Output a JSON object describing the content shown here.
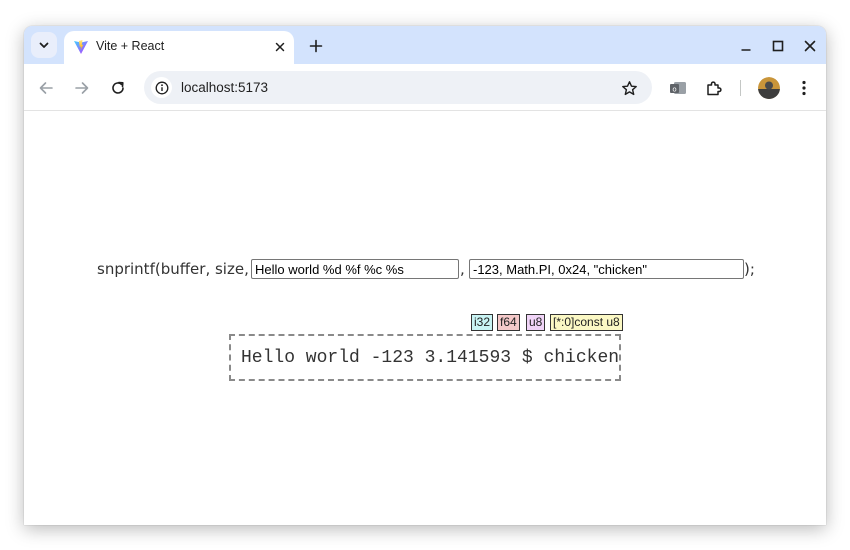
{
  "browser": {
    "tab": {
      "title": "Vite + React"
    },
    "address_bar": {
      "url": "localhost:5173"
    }
  },
  "app": {
    "prefix": "snprintf(buffer, size,",
    "comma": ",",
    "suffix": ");",
    "format_value": "Hello world %d %f %c %s",
    "args_value": "-123, Math.PI, 0x24, \"chicken\"",
    "types": [
      {
        "label": "i32",
        "color": "#c9f4f4"
      },
      {
        "label": "f64",
        "color": "#f4c9c9"
      },
      {
        "label": "u8",
        "color": "#f0d4f7"
      },
      {
        "label": "[*:0]const u8",
        "color": "#fbf8c4"
      }
    ],
    "output": "Hello world -123 3.141593 $ chicken"
  }
}
